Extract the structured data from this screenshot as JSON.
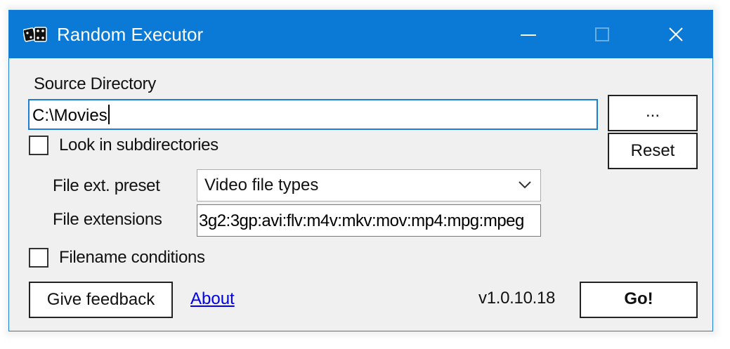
{
  "window": {
    "title": "Random Executor",
    "icon": "dice-icon"
  },
  "titlebar_buttons": {
    "minimize": "minimize-icon",
    "maximize": "maximize-icon",
    "close": "close-icon"
  },
  "source": {
    "label": "Source Directory",
    "value": "C:\\Movies",
    "browse_label": "...",
    "reset_label": "Reset"
  },
  "options": {
    "subdirectories_label": "Look in subdirectories",
    "subdirectories_checked": false,
    "filename_conditions_label": "Filename conditions",
    "filename_conditions_checked": false
  },
  "extensions": {
    "preset_label": "File ext. preset",
    "preset_value": "Video file types",
    "extensions_label": "File extensions",
    "extensions_value": "3g2:3gp:avi:flv:m4v:mkv:mov:mp4:mpg:mpeg"
  },
  "footer": {
    "feedback_label": "Give feedback",
    "about_label": "About",
    "version": "v1.0.10.18",
    "go_label": "Go!"
  },
  "colors": {
    "titlebar": "#0a7ad6",
    "accent": "#1d7fd4",
    "window_bg": "#f0f0f0",
    "link": "#0000ee"
  }
}
